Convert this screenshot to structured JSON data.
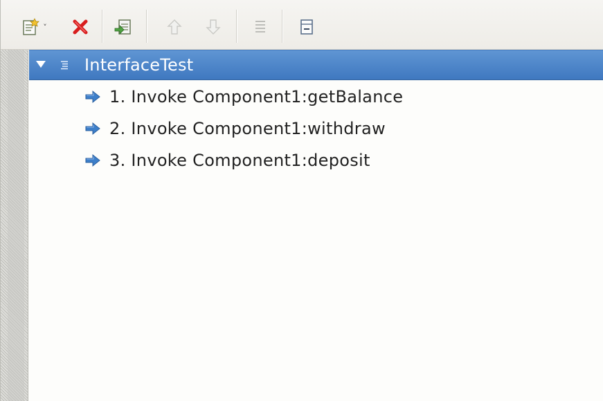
{
  "toolbar": {
    "buttons": [
      {
        "icon": "new-step-icon",
        "has_dropdown": true,
        "enabled": true
      },
      {
        "icon": "delete-icon",
        "enabled": true
      },
      {
        "icon": "import-icon",
        "enabled": true
      },
      {
        "icon": "move-up-icon",
        "enabled": false
      },
      {
        "icon": "move-down-icon",
        "enabled": false
      },
      {
        "icon": "properties-icon",
        "enabled": false
      },
      {
        "icon": "collapse-all-icon",
        "enabled": true
      }
    ],
    "dropdown_glyph": "˅"
  },
  "tree": {
    "root": {
      "label": "InterfaceTest",
      "expanded": true,
      "selected": true
    },
    "children": [
      {
        "label": "1. Invoke Component1:getBalance"
      },
      {
        "label": "2. Invoke Component1:withdraw"
      },
      {
        "label": "3. Invoke Component1:deposit"
      }
    ]
  },
  "colors": {
    "selection": "#4a82c9",
    "arrow": "#3d7fc9",
    "delete": "#d81d1d",
    "text": "#222222"
  }
}
